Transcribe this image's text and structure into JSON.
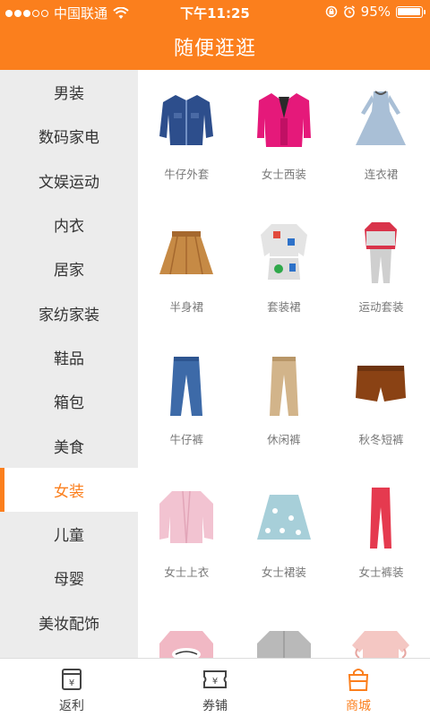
{
  "status_bar": {
    "carrier": "中国联通",
    "time": "下午11:25",
    "battery": "95%",
    "battery_level": 0.95,
    "icons": [
      "signal-dots-icon",
      "wifi-icon",
      "rotation-lock-icon",
      "alarm-icon",
      "battery-icon"
    ]
  },
  "header": {
    "title": "随便逛逛"
  },
  "colors": {
    "accent": "#fb7f1d",
    "sidebar_bg": "#ececec"
  },
  "sidebar": {
    "items": [
      {
        "label": "男装"
      },
      {
        "label": "数码家电"
      },
      {
        "label": "文娱运动"
      },
      {
        "label": "内衣"
      },
      {
        "label": "居家"
      },
      {
        "label": "家纺家装"
      },
      {
        "label": "鞋品"
      },
      {
        "label": "箱包"
      },
      {
        "label": "美食"
      },
      {
        "label": "女装",
        "active": true
      },
      {
        "label": "儿童"
      },
      {
        "label": "母婴"
      },
      {
        "label": "美妆配饰"
      }
    ]
  },
  "products": [
    {
      "label": "牛仔外套",
      "icon": "denim-jacket-icon"
    },
    {
      "label": "女士西装",
      "icon": "blazer-icon"
    },
    {
      "label": "连衣裙",
      "icon": "dress-icon"
    },
    {
      "label": "半身裙",
      "icon": "skirt-icon"
    },
    {
      "label": "套装裙",
      "icon": "skirt-set-icon"
    },
    {
      "label": "运动套装",
      "icon": "tracksuit-icon"
    },
    {
      "label": "牛仔裤",
      "icon": "jeans-icon"
    },
    {
      "label": "休闲裤",
      "icon": "casual-pants-icon"
    },
    {
      "label": "秋冬短裤",
      "icon": "shorts-icon"
    },
    {
      "label": "女士上衣",
      "icon": "cardigan-icon"
    },
    {
      "label": "女士裙装",
      "icon": "floral-skirt-icon"
    },
    {
      "label": "女士裤装",
      "icon": "red-pants-icon"
    },
    {
      "label": "",
      "icon": "sweater-icon"
    },
    {
      "label": "",
      "icon": "coat-icon"
    },
    {
      "label": "",
      "icon": "blouse-icon"
    }
  ],
  "tabbar": {
    "tabs": [
      {
        "label": "返利",
        "icon": "rebate-icon"
      },
      {
        "label": "券铺",
        "icon": "coupon-icon"
      },
      {
        "label": "商城",
        "icon": "shopping-bag-icon",
        "active": true
      }
    ]
  }
}
